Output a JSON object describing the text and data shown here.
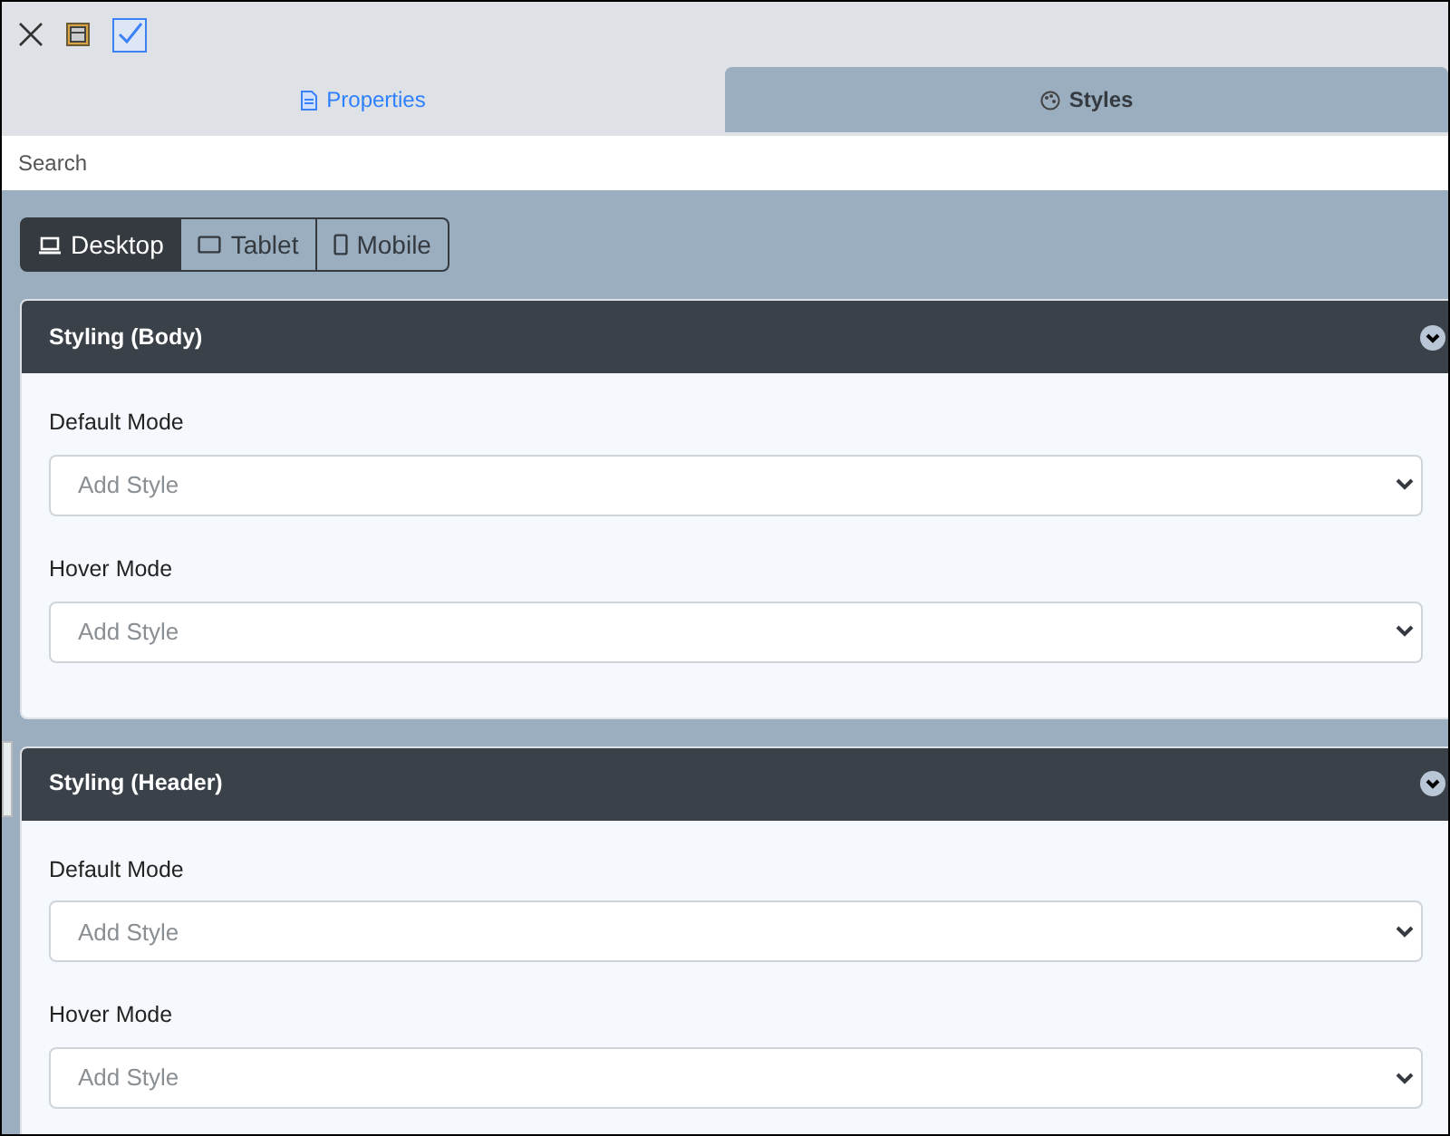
{
  "tabs": [
    {
      "label": "Properties",
      "kind": "document",
      "selected": false
    },
    {
      "label": "Styles",
      "kind": "palette",
      "selected": true
    }
  ],
  "search": {
    "placeholder": "Search"
  },
  "devices": [
    {
      "label": "Desktop",
      "kind": "laptop",
      "selected": true
    },
    {
      "label": "Tablet",
      "kind": "tablet",
      "selected": false
    },
    {
      "label": "Mobile",
      "kind": "phone",
      "selected": false
    }
  ],
  "panels": [
    {
      "title": "Styling (Body)",
      "expanded": true,
      "fields": [
        {
          "label": "Default Mode",
          "placeholder": "Add Style"
        },
        {
          "label": "Hover Mode",
          "placeholder": "Add Style"
        }
      ]
    },
    {
      "title": "Styling (Header)",
      "expanded": true,
      "fields": [
        {
          "label": "Default Mode",
          "placeholder": "Add Style"
        },
        {
          "label": "Hover Mode",
          "placeholder": "Add Style"
        }
      ]
    }
  ]
}
